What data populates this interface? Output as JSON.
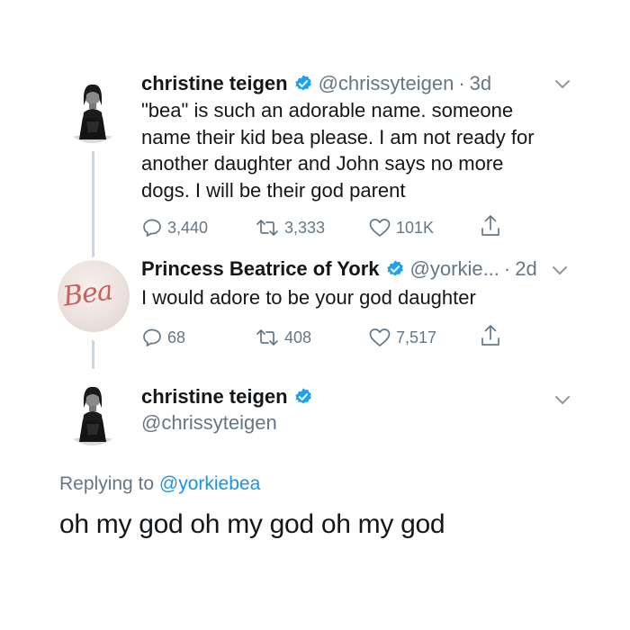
{
  "tweet1": {
    "name": "christine teigen",
    "handle": "@chrissyteigen",
    "dot": "·",
    "time": "3d",
    "lines": [
      "\"bea\" is such an adorable name. someone",
      "name their kid bea please. I am not ready for",
      "another daughter and John says no more",
      "dogs. I will be their god parent"
    ],
    "replies": "3,440",
    "retweets": "3,333",
    "likes": "101K"
  },
  "tweet2": {
    "name": "Princess Beatrice of York",
    "handle": "@yorkie...",
    "dot": "·",
    "time": "2d",
    "text": "I would adore to be your god daughter",
    "avatar_script": "Bea",
    "replies": "68",
    "retweets": "408",
    "likes": "7,517"
  },
  "tweet3": {
    "name": "christine teigen",
    "handle": "@chrissyteigen",
    "replying_prefix": "Replying to",
    "replying_mention": "@yorkiebea",
    "text": "oh my god oh my god oh my god"
  },
  "colors": {
    "text": "#14171a",
    "secondary": "#657786",
    "link": "#1b95e0",
    "verified": "#1da1f2",
    "thread_line": "#cfd6dc"
  },
  "icons": [
    "verified-badge-icon",
    "chevron-down-icon",
    "reply-icon",
    "retweet-icon",
    "like-icon",
    "share-icon"
  ]
}
